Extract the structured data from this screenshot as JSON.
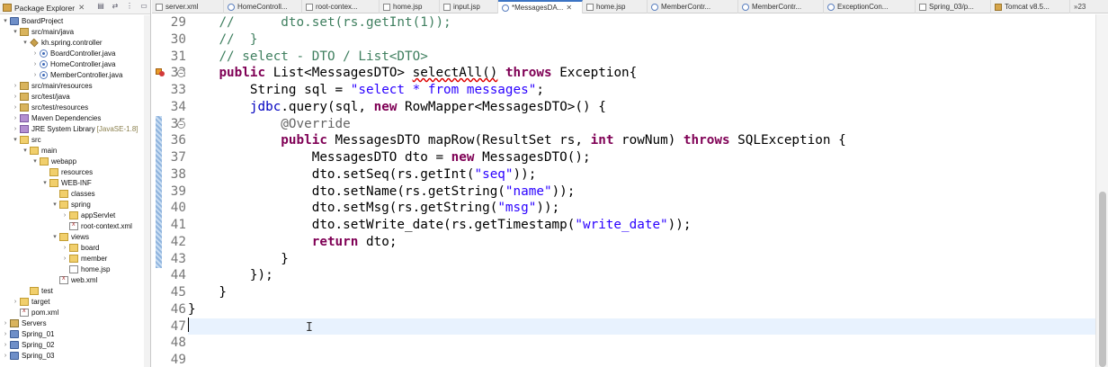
{
  "package_explorer": {
    "title": "Package Explorer",
    "tree": [
      {
        "label": "BoardProject",
        "icon": "project-icon",
        "arrow": "▾",
        "depth": 0
      },
      {
        "label": "src/main/java",
        "icon": "src-folder-icon",
        "arrow": "▾",
        "depth": 1
      },
      {
        "label": "kh.spring.controller",
        "icon": "package-icon",
        "arrow": "▾",
        "depth": 2
      },
      {
        "label": "BoardController.java",
        "icon": "java-file-icon",
        "arrow": "›",
        "depth": 3
      },
      {
        "label": "HomeController.java",
        "icon": "java-file-icon",
        "arrow": "›",
        "depth": 3
      },
      {
        "label": "MemberController.java",
        "icon": "java-file-icon",
        "arrow": "›",
        "depth": 3
      },
      {
        "label": "src/main/resources",
        "icon": "src-folder-icon",
        "arrow": "›",
        "depth": 1
      },
      {
        "label": "src/test/java",
        "icon": "src-folder-icon",
        "arrow": "›",
        "depth": 1
      },
      {
        "label": "src/test/resources",
        "icon": "src-folder-icon",
        "arrow": "›",
        "depth": 1
      },
      {
        "label": "Maven Dependencies",
        "icon": "library-icon",
        "arrow": "›",
        "depth": 1
      },
      {
        "label": "JRE System Library",
        "suffix": "[JavaSE-1.8]",
        "icon": "library-icon",
        "arrow": "›",
        "depth": 1
      },
      {
        "label": "src",
        "icon": "folder-icon",
        "arrow": "▾",
        "depth": 1
      },
      {
        "label": "main",
        "icon": "folder-icon",
        "arrow": "▾",
        "depth": 2
      },
      {
        "label": "webapp",
        "icon": "folder-icon",
        "arrow": "▾",
        "depth": 3
      },
      {
        "label": "resources",
        "icon": "folder-icon",
        "arrow": "",
        "depth": 4
      },
      {
        "label": "WEB-INF",
        "icon": "folder-icon",
        "arrow": "▾",
        "depth": 4
      },
      {
        "label": "classes",
        "icon": "folder-icon",
        "arrow": "",
        "depth": 5
      },
      {
        "label": "spring",
        "icon": "folder-icon",
        "arrow": "▾",
        "depth": 5
      },
      {
        "label": "appServlet",
        "icon": "folder-icon",
        "arrow": "›",
        "depth": 6
      },
      {
        "label": "root-context.xml",
        "icon": "xml-file-icon",
        "arrow": "",
        "depth": 6
      },
      {
        "label": "views",
        "icon": "folder-icon",
        "arrow": "▾",
        "depth": 5
      },
      {
        "label": "board",
        "icon": "folder-icon",
        "arrow": "›",
        "depth": 6
      },
      {
        "label": "member",
        "icon": "folder-icon",
        "arrow": "›",
        "depth": 6
      },
      {
        "label": "home.jsp",
        "icon": "jsp-file-icon",
        "arrow": "",
        "depth": 6
      },
      {
        "label": "web.xml",
        "icon": "xml-file-icon",
        "arrow": "",
        "depth": 5
      },
      {
        "label": "test",
        "icon": "folder-icon",
        "arrow": "",
        "depth": 2
      },
      {
        "label": "target",
        "icon": "folder-icon",
        "arrow": "›",
        "depth": 1
      },
      {
        "label": "pom.xml",
        "icon": "xml-file-icon",
        "arrow": "",
        "depth": 1
      },
      {
        "label": "Servers",
        "icon": "server-folder-icon",
        "arrow": "›",
        "depth": 0
      },
      {
        "label": "Spring_01",
        "icon": "project-icon",
        "arrow": "›",
        "depth": 0
      },
      {
        "label": "Spring_02",
        "icon": "project-icon",
        "arrow": "›",
        "depth": 0
      },
      {
        "label": "Spring_03",
        "icon": "project-icon",
        "arrow": "›",
        "depth": 0
      }
    ]
  },
  "tabs": [
    {
      "label": "server.xml",
      "icon": "xml",
      "active": false
    },
    {
      "label": "HomeControll...",
      "icon": "java",
      "active": false
    },
    {
      "label": "root-contex...",
      "icon": "xml",
      "active": false
    },
    {
      "label": "home.jsp",
      "icon": "jsp",
      "active": false
    },
    {
      "label": "input.jsp",
      "icon": "jsp",
      "active": false
    },
    {
      "label": "*MessagesDA...",
      "icon": "java",
      "active": true,
      "close": "✕"
    },
    {
      "label": "home.jsp",
      "icon": "jsp",
      "active": false
    },
    {
      "label": "MemberContr...",
      "icon": "java",
      "active": false
    },
    {
      "label": "MemberContr...",
      "icon": "java",
      "active": false
    },
    {
      "label": "ExceptionCon...",
      "icon": "java",
      "active": false
    },
    {
      "label": "Spring_03/p...",
      "icon": "xml",
      "active": false
    },
    {
      "label": "Tomcat v8.5...",
      "icon": "srv",
      "active": false
    }
  ],
  "tabs_overflow": "»23",
  "editor": {
    "lines": [
      {
        "n": "29",
        "fold": "",
        "marker": "",
        "segs": [
          [
            "",
            "    "
          ],
          [
            "cmt",
            "//      dto.set(rs.getInt(1));"
          ]
        ]
      },
      {
        "n": "30",
        "fold": "",
        "marker": "",
        "segs": [
          [
            "",
            "    "
          ],
          [
            "cmt",
            "//  }"
          ]
        ]
      },
      {
        "n": "31",
        "fold": "",
        "marker": "",
        "segs": [
          [
            "",
            "    "
          ],
          [
            "cmt",
            "// select - DTO / List<DTO>"
          ]
        ]
      },
      {
        "n": "32",
        "fold": "⊖",
        "marker": "warn-error",
        "segs": [
          [
            "",
            "    "
          ],
          [
            "kw",
            "public"
          ],
          [
            "",
            " List<MessagesDTO> "
          ],
          [
            "err",
            "selectAll()"
          ],
          [
            "",
            " "
          ],
          [
            "kw",
            "throws"
          ],
          [
            "",
            " Exception{"
          ]
        ]
      },
      {
        "n": "33",
        "fold": "",
        "marker": "",
        "segs": [
          [
            "",
            "        String sql = "
          ],
          [
            "str",
            "\"select * from messages\""
          ],
          [
            "",
            ";"
          ]
        ]
      },
      {
        "n": "34",
        "fold": "",
        "marker": "",
        "segs": [
          [
            "",
            "        "
          ],
          [
            "fld",
            "jdbc"
          ],
          [
            "",
            ".query(sql, "
          ],
          [
            "kw",
            "new"
          ],
          [
            "",
            " RowMapper<MessagesDTO>() {"
          ]
        ]
      },
      {
        "n": "35",
        "fold": "⊖",
        "marker": "",
        "segs": [
          [
            "",
            "            "
          ],
          [
            "ann",
            "@Override"
          ]
        ]
      },
      {
        "n": "36",
        "fold": "",
        "marker": "",
        "segs": [
          [
            "",
            "            "
          ],
          [
            "kw",
            "public"
          ],
          [
            "",
            " MessagesDTO mapRow(ResultSet rs, "
          ],
          [
            "kw",
            "int"
          ],
          [
            "",
            " rowNum) "
          ],
          [
            "kw",
            "throws"
          ],
          [
            "",
            " SQLException {"
          ]
        ]
      },
      {
        "n": "37",
        "fold": "",
        "marker": "",
        "segs": [
          [
            "",
            "                MessagesDTO dto = "
          ],
          [
            "kw",
            "new"
          ],
          [
            "",
            " MessagesDTO();"
          ]
        ]
      },
      {
        "n": "38",
        "fold": "",
        "marker": "",
        "segs": [
          [
            "",
            "                dto.setSeq(rs.getInt("
          ],
          [
            "str",
            "\"seq\""
          ],
          [
            "",
            "));"
          ]
        ]
      },
      {
        "n": "39",
        "fold": "",
        "marker": "",
        "segs": [
          [
            "",
            "                dto.setName(rs.getString("
          ],
          [
            "str",
            "\"name\""
          ],
          [
            "",
            "));"
          ]
        ]
      },
      {
        "n": "40",
        "fold": "",
        "marker": "",
        "segs": [
          [
            "",
            "                dto.setMsg(rs.getString("
          ],
          [
            "str",
            "\"msg\""
          ],
          [
            "",
            "));"
          ]
        ]
      },
      {
        "n": "41",
        "fold": "",
        "marker": "",
        "segs": [
          [
            "",
            "                dto.setWrite_date(rs.getTimestamp("
          ],
          [
            "str",
            "\"write_date\""
          ],
          [
            "",
            "));"
          ]
        ]
      },
      {
        "n": "42",
        "fold": "",
        "marker": "",
        "segs": [
          [
            "",
            "                "
          ],
          [
            "kw",
            "return"
          ],
          [
            "",
            " dto;"
          ]
        ]
      },
      {
        "n": "43",
        "fold": "",
        "marker": "",
        "segs": [
          [
            "",
            "            }"
          ]
        ]
      },
      {
        "n": "44",
        "fold": "",
        "marker": "",
        "segs": [
          [
            "",
            "        });"
          ]
        ]
      },
      {
        "n": "45",
        "fold": "",
        "marker": "",
        "segs": [
          [
            "",
            "    }"
          ]
        ]
      },
      {
        "n": "46",
        "fold": "",
        "marker": "",
        "segs": [
          [
            "",
            "}"
          ]
        ]
      },
      {
        "n": "47",
        "fold": "",
        "marker": "",
        "current": true,
        "segs": [
          [
            "",
            ""
          ]
        ]
      },
      {
        "n": "48",
        "fold": "",
        "marker": "",
        "segs": [
          [
            "",
            ""
          ]
        ]
      },
      {
        "n": "49",
        "fold": "",
        "marker": "",
        "segs": [
          [
            "",
            ""
          ]
        ]
      }
    ],
    "ibeam": "I"
  }
}
